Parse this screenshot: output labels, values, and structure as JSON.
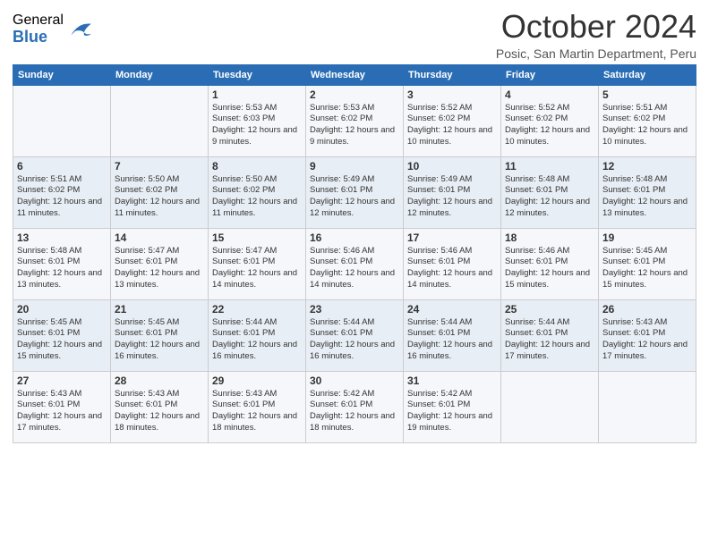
{
  "logo": {
    "general": "General",
    "blue": "Blue"
  },
  "header": {
    "month": "October 2024",
    "location": "Posic, San Martin Department, Peru"
  },
  "weekdays": [
    "Sunday",
    "Monday",
    "Tuesday",
    "Wednesday",
    "Thursday",
    "Friday",
    "Saturday"
  ],
  "weeks": [
    [
      {
        "day": "",
        "info": ""
      },
      {
        "day": "",
        "info": ""
      },
      {
        "day": "1",
        "info": "Sunrise: 5:53 AM\nSunset: 6:03 PM\nDaylight: 12 hours and 9 minutes."
      },
      {
        "day": "2",
        "info": "Sunrise: 5:53 AM\nSunset: 6:02 PM\nDaylight: 12 hours and 9 minutes."
      },
      {
        "day": "3",
        "info": "Sunrise: 5:52 AM\nSunset: 6:02 PM\nDaylight: 12 hours and 10 minutes."
      },
      {
        "day": "4",
        "info": "Sunrise: 5:52 AM\nSunset: 6:02 PM\nDaylight: 12 hours and 10 minutes."
      },
      {
        "day": "5",
        "info": "Sunrise: 5:51 AM\nSunset: 6:02 PM\nDaylight: 12 hours and 10 minutes."
      }
    ],
    [
      {
        "day": "6",
        "info": "Sunrise: 5:51 AM\nSunset: 6:02 PM\nDaylight: 12 hours and 11 minutes."
      },
      {
        "day": "7",
        "info": "Sunrise: 5:50 AM\nSunset: 6:02 PM\nDaylight: 12 hours and 11 minutes."
      },
      {
        "day": "8",
        "info": "Sunrise: 5:50 AM\nSunset: 6:02 PM\nDaylight: 12 hours and 11 minutes."
      },
      {
        "day": "9",
        "info": "Sunrise: 5:49 AM\nSunset: 6:01 PM\nDaylight: 12 hours and 12 minutes."
      },
      {
        "day": "10",
        "info": "Sunrise: 5:49 AM\nSunset: 6:01 PM\nDaylight: 12 hours and 12 minutes."
      },
      {
        "day": "11",
        "info": "Sunrise: 5:48 AM\nSunset: 6:01 PM\nDaylight: 12 hours and 12 minutes."
      },
      {
        "day": "12",
        "info": "Sunrise: 5:48 AM\nSunset: 6:01 PM\nDaylight: 12 hours and 13 minutes."
      }
    ],
    [
      {
        "day": "13",
        "info": "Sunrise: 5:48 AM\nSunset: 6:01 PM\nDaylight: 12 hours and 13 minutes."
      },
      {
        "day": "14",
        "info": "Sunrise: 5:47 AM\nSunset: 6:01 PM\nDaylight: 12 hours and 13 minutes."
      },
      {
        "day": "15",
        "info": "Sunrise: 5:47 AM\nSunset: 6:01 PM\nDaylight: 12 hours and 14 minutes."
      },
      {
        "day": "16",
        "info": "Sunrise: 5:46 AM\nSunset: 6:01 PM\nDaylight: 12 hours and 14 minutes."
      },
      {
        "day": "17",
        "info": "Sunrise: 5:46 AM\nSunset: 6:01 PM\nDaylight: 12 hours and 14 minutes."
      },
      {
        "day": "18",
        "info": "Sunrise: 5:46 AM\nSunset: 6:01 PM\nDaylight: 12 hours and 15 minutes."
      },
      {
        "day": "19",
        "info": "Sunrise: 5:45 AM\nSunset: 6:01 PM\nDaylight: 12 hours and 15 minutes."
      }
    ],
    [
      {
        "day": "20",
        "info": "Sunrise: 5:45 AM\nSunset: 6:01 PM\nDaylight: 12 hours and 15 minutes."
      },
      {
        "day": "21",
        "info": "Sunrise: 5:45 AM\nSunset: 6:01 PM\nDaylight: 12 hours and 16 minutes."
      },
      {
        "day": "22",
        "info": "Sunrise: 5:44 AM\nSunset: 6:01 PM\nDaylight: 12 hours and 16 minutes."
      },
      {
        "day": "23",
        "info": "Sunrise: 5:44 AM\nSunset: 6:01 PM\nDaylight: 12 hours and 16 minutes."
      },
      {
        "day": "24",
        "info": "Sunrise: 5:44 AM\nSunset: 6:01 PM\nDaylight: 12 hours and 16 minutes."
      },
      {
        "day": "25",
        "info": "Sunrise: 5:44 AM\nSunset: 6:01 PM\nDaylight: 12 hours and 17 minutes."
      },
      {
        "day": "26",
        "info": "Sunrise: 5:43 AM\nSunset: 6:01 PM\nDaylight: 12 hours and 17 minutes."
      }
    ],
    [
      {
        "day": "27",
        "info": "Sunrise: 5:43 AM\nSunset: 6:01 PM\nDaylight: 12 hours and 17 minutes."
      },
      {
        "day": "28",
        "info": "Sunrise: 5:43 AM\nSunset: 6:01 PM\nDaylight: 12 hours and 18 minutes."
      },
      {
        "day": "29",
        "info": "Sunrise: 5:43 AM\nSunset: 6:01 PM\nDaylight: 12 hours and 18 minutes."
      },
      {
        "day": "30",
        "info": "Sunrise: 5:42 AM\nSunset: 6:01 PM\nDaylight: 12 hours and 18 minutes."
      },
      {
        "day": "31",
        "info": "Sunrise: 5:42 AM\nSunset: 6:01 PM\nDaylight: 12 hours and 19 minutes."
      },
      {
        "day": "",
        "info": ""
      },
      {
        "day": "",
        "info": ""
      }
    ]
  ]
}
